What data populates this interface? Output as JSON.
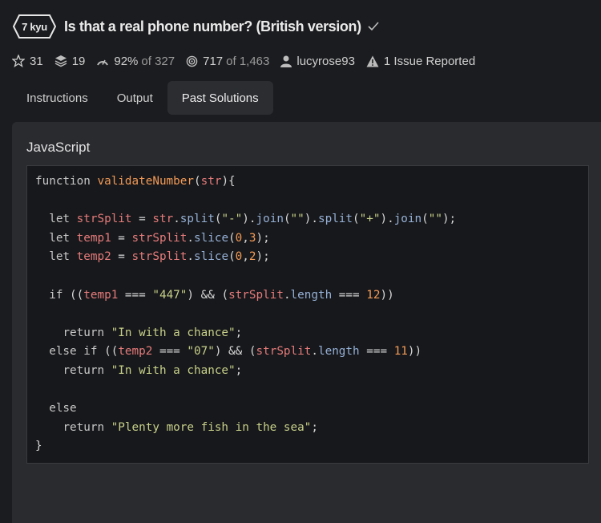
{
  "kata": {
    "rank": "7 kyu",
    "title": "Is that a real phone number? (British version)"
  },
  "stats": {
    "stars": "31",
    "collections": "19",
    "satisfaction_pct": "92%",
    "satisfaction_of": "of 327",
    "completed": "717",
    "completed_of": "of 1,463",
    "author": "lucyrose93",
    "issues": "1 Issue Reported"
  },
  "tabs": [
    {
      "label": "Instructions",
      "active": false
    },
    {
      "label": "Output",
      "active": false
    },
    {
      "label": "Past Solutions",
      "active": true
    }
  ],
  "solution": {
    "language": "JavaScript",
    "code_lines": [
      "function validateNumber(str){",
      "",
      "  let strSplit = str.split(\"-\").join(\"\").split(\"+\").join(\"\");",
      "  let temp1 = strSplit.slice(0,3);",
      "  let temp2 = strSplit.slice(0,2);",
      "",
      "  if ((temp1 === \"447\") && (strSplit.length === 12))",
      "",
      "    return \"In with a chance\";",
      "  else if ((temp2 === \"07\") && (strSplit.length === 11))",
      "    return \"In with a chance\";",
      "",
      "  else",
      "    return \"Plenty more fish in the sea\";",
      "}"
    ]
  },
  "icons": {
    "star": "star-icon",
    "collections": "layers-icon",
    "satisfaction": "gauge-icon",
    "completed": "target-icon",
    "author": "user-icon",
    "issues": "warning-icon",
    "completed_check": "check-icon"
  }
}
